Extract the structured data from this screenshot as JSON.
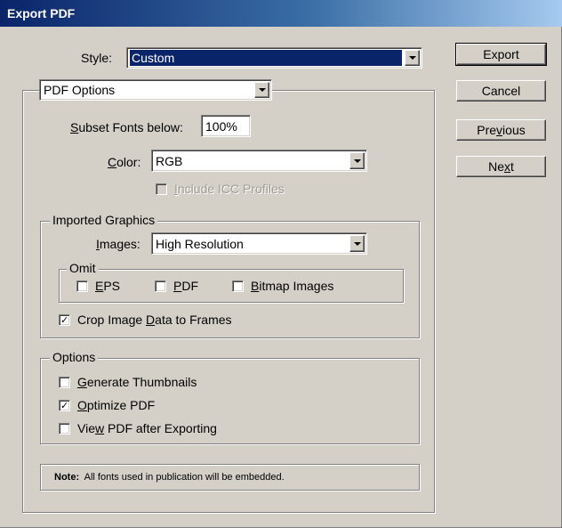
{
  "window": {
    "title": "Export PDF"
  },
  "style": {
    "label": "Style:",
    "value": "Custom"
  },
  "tabs": {
    "selected": "PDF Options"
  },
  "subset_fonts": {
    "label": "Subset Fonts below:",
    "label_key": "S",
    "label_rest": "ubset Fonts below:",
    "value": "100%"
  },
  "color": {
    "label_key": "C",
    "label_rest": "olor:",
    "value": "RGB"
  },
  "include_icc": {
    "label_key": "I",
    "label_rest": "nclude ICC Profiles",
    "checked": false,
    "enabled": false
  },
  "imported_graphics": {
    "legend": "Imported Graphics",
    "images": {
      "label_key": "I",
      "label_rest": "mages:",
      "value": "High Resolution"
    },
    "omit": {
      "legend": "Omit",
      "eps": {
        "label_key": "E",
        "label_rest": "PS",
        "checked": false
      },
      "pdf": {
        "label_key": "P",
        "label_rest": "DF",
        "checked": false
      },
      "bitmap": {
        "label_key": "B",
        "label_rest": "itmap Images",
        "checked": false
      }
    },
    "crop": {
      "label_pre": "Crop Image ",
      "label_key": "D",
      "label_rest": "ata to Frames",
      "checked": true
    }
  },
  "options": {
    "legend": "Options",
    "thumbnails": {
      "label_key": "G",
      "label_rest": "enerate Thumbnails",
      "checked": false
    },
    "optimize": {
      "label_key": "O",
      "label_rest": "ptimize PDF",
      "checked": true
    },
    "view_after": {
      "label_pre": "Vie",
      "label_key": "w",
      "label_rest": " PDF after Exporting",
      "checked": false
    }
  },
  "note": {
    "bold": "Note:",
    "text": "All fonts used in publication will be embedded."
  },
  "buttons": {
    "export": "Export",
    "cancel": "Cancel",
    "previous_pre": "Pre",
    "previous_key": "v",
    "previous_rest": "ious",
    "next_pre": "Ne",
    "next_key": "x",
    "next_rest": "t"
  },
  "colors": {
    "face": "#d4d0c8",
    "title_start": "#0a246a",
    "title_end": "#a6caf0",
    "selection": "#0a246a"
  }
}
